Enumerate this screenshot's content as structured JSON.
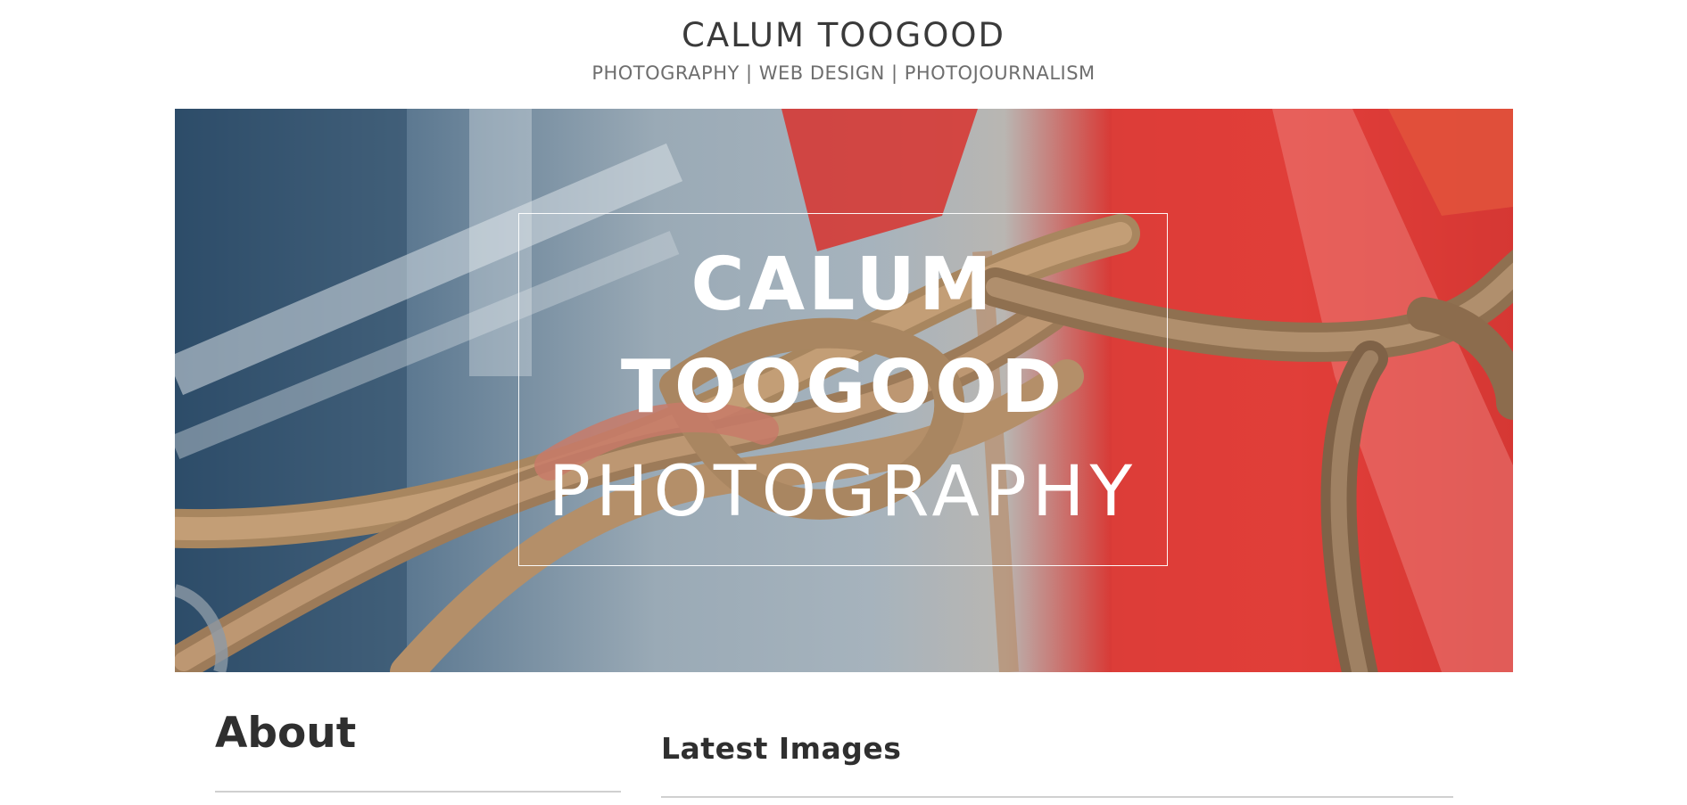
{
  "header": {
    "title": "CALUM TOOGOOD",
    "tagline": "PHOTOGRAPHY | WEB DESIGN | PHOTOJOURNALISM"
  },
  "hero": {
    "line1": "CALUM",
    "line2": "TOOGOOD",
    "line3": "PHOTOGRAPHY",
    "image_description_icon": "rope-knot-photo"
  },
  "sections": {
    "about_title": "About",
    "latest_title": "Latest Images"
  },
  "colors": {
    "text_dark": "#2f2f2f",
    "text_muted": "#6e6e6e",
    "rule": "#d0d0d0",
    "hero_red": "#e23c38",
    "hero_blue": "#2f4f6d"
  }
}
